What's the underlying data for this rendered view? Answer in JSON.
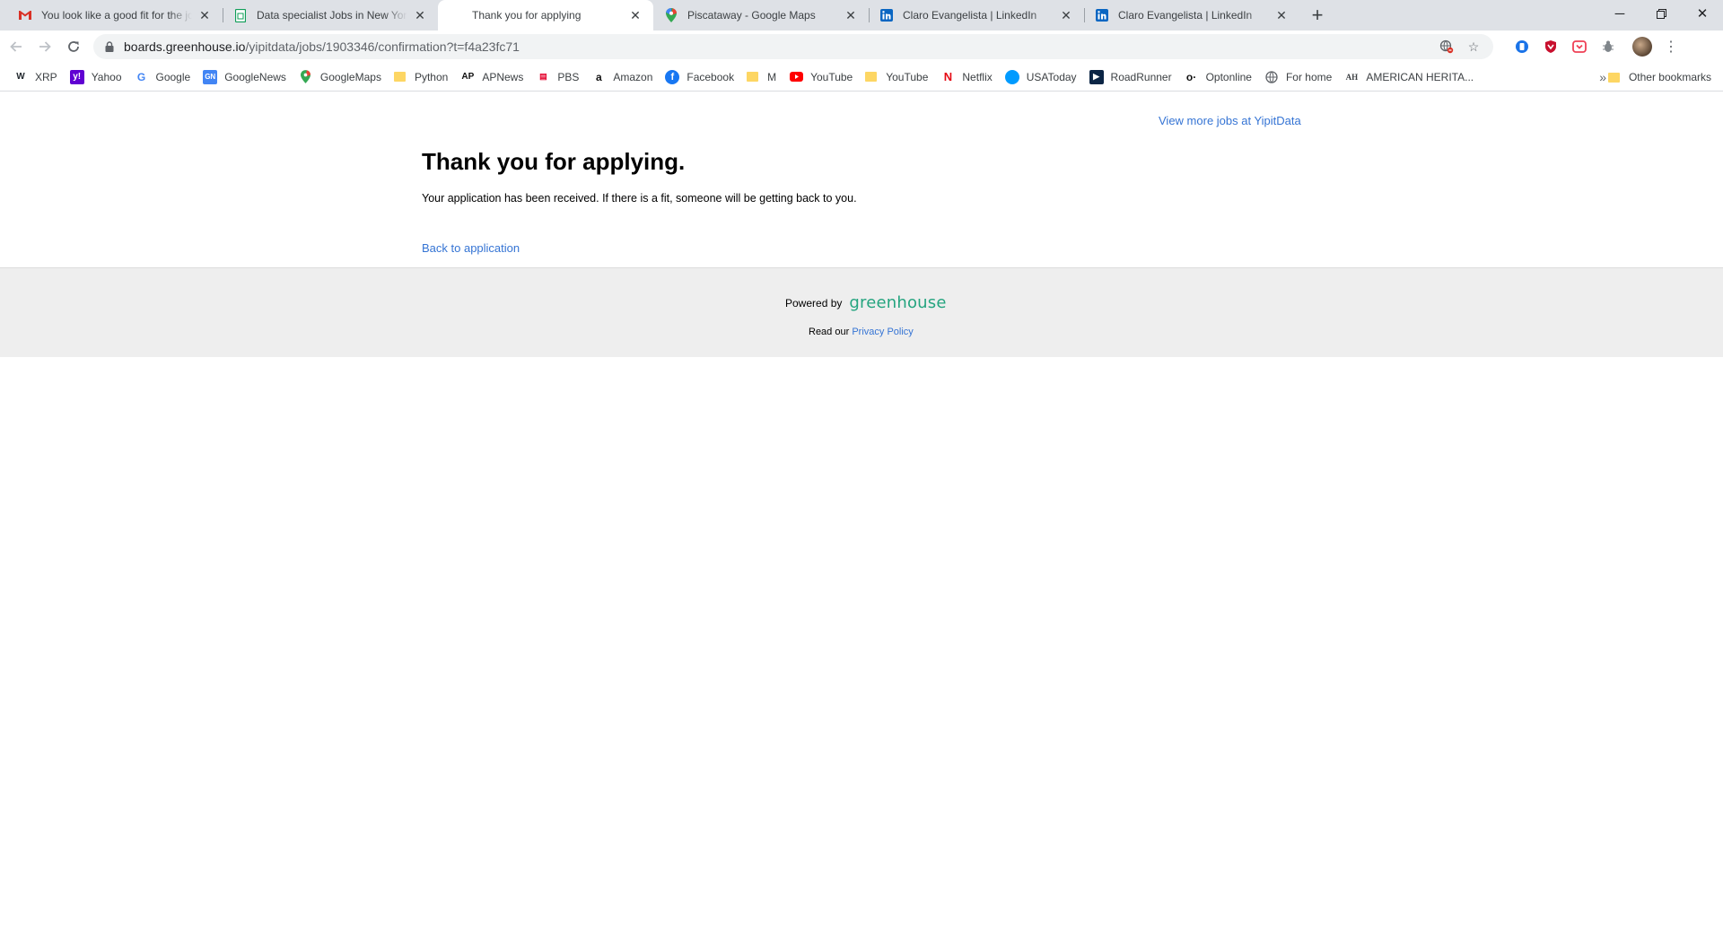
{
  "browser": {
    "tabs": [
      {
        "title": "You look like a good fit for the jo",
        "icon": "gmail-icon",
        "color": "#d93025",
        "active": false
      },
      {
        "title": "Data specialist Jobs in New York,",
        "icon": "sheets-icon",
        "color": "#0f9d58",
        "active": false
      },
      {
        "title": "Thank you for applying",
        "icon": "none",
        "color": "",
        "active": true
      },
      {
        "title": "Piscataway - Google Maps",
        "icon": "maps-icon",
        "color": "#34a853",
        "active": false
      },
      {
        "title": "Claro Evangelista | LinkedIn",
        "icon": "linkedin-icon",
        "color": "#0a66c2",
        "active": false
      },
      {
        "title": "Claro Evangelista | LinkedIn",
        "icon": "linkedin-icon",
        "color": "#0a66c2",
        "active": false
      }
    ],
    "url_host": "boards.greenhouse.io",
    "url_path": "/yipitdata/jobs/1903346/confirmation?t=f4a23fc71",
    "bookmarks": [
      {
        "label": "XRP",
        "icon": "xrp-icon",
        "color": "#23292f"
      },
      {
        "label": "Yahoo",
        "icon": "yahoo-icon",
        "color": "#6001d2"
      },
      {
        "label": "Google",
        "icon": "google-icon",
        "color": "#4285f4"
      },
      {
        "label": "GoogleNews",
        "icon": "google-news-icon",
        "color": "#4285f4"
      },
      {
        "label": "GoogleMaps",
        "icon": "maps-icon",
        "color": "#34a853"
      },
      {
        "label": "Python",
        "icon": "folder-icon",
        "color": "#fdd663"
      },
      {
        "label": "APNews",
        "icon": "ap-icon",
        "color": "#e4002b"
      },
      {
        "label": "PBS",
        "icon": "pbs-icon",
        "color": "#e4002b"
      },
      {
        "label": "Amazon",
        "icon": "amazon-icon",
        "color": "#111111"
      },
      {
        "label": "Facebook",
        "icon": "facebook-icon",
        "color": "#1877f2"
      },
      {
        "label": "M",
        "icon": "folder-icon",
        "color": "#fdd663"
      },
      {
        "label": "YouTube",
        "icon": "youtube-icon",
        "color": "#ff0000"
      },
      {
        "label": "YouTube",
        "icon": "folder-icon",
        "color": "#fdd663"
      },
      {
        "label": "Netflix",
        "icon": "netflix-icon",
        "color": "#e50914"
      },
      {
        "label": "USAToday",
        "icon": "usatoday-icon",
        "color": "#009bff"
      },
      {
        "label": "RoadRunner",
        "icon": "roadrunner-icon",
        "color": "#0b2545"
      },
      {
        "label": "Optonline",
        "icon": "optonline-icon",
        "color": "#111111"
      },
      {
        "label": "For home",
        "icon": "globe-icon",
        "color": "#5f6368"
      },
      {
        "label": "AMERICAN HERITA...",
        "icon": "ah-icon",
        "color": "#5f6368"
      }
    ],
    "other_bookmarks": "Other bookmarks"
  },
  "page": {
    "view_more": "View more jobs at YipitData",
    "heading": "Thank you for applying.",
    "message": "Your application has been received. If there is a fit, someone will be getting back to you.",
    "back_link": "Back to application",
    "powered_by": "Powered by",
    "logo_text": "greenhouse",
    "read_our": "Read our",
    "privacy_link": "Privacy Policy"
  },
  "colors": {
    "link": "#3574d4",
    "greenhouse_green": "#24a47f",
    "footer_bg": "#eeeeee"
  }
}
